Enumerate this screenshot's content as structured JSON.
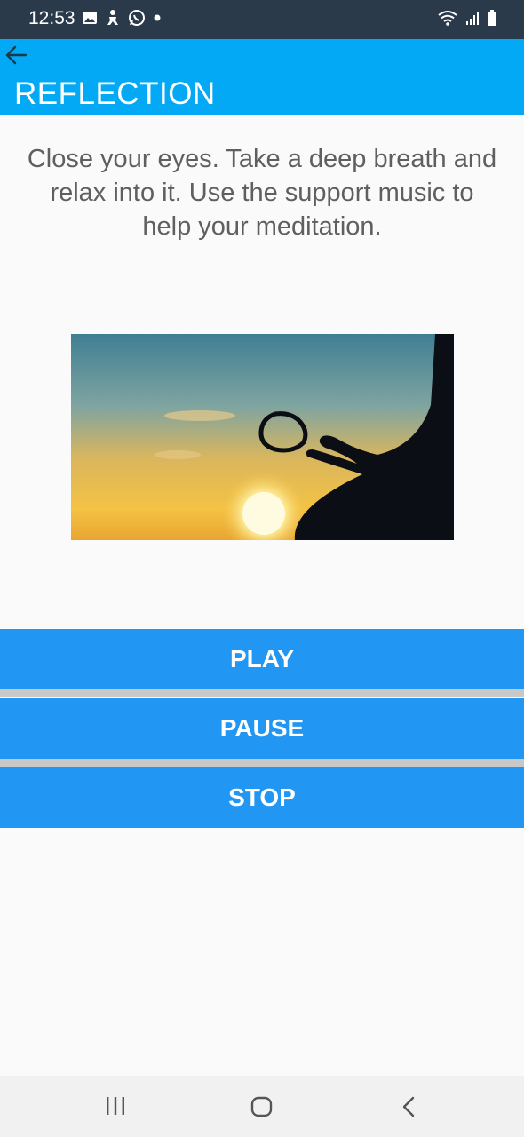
{
  "status_bar": {
    "time": "12:53",
    "icons_left": [
      "gallery-icon",
      "accessibility-icon",
      "whatsapp-icon",
      "notification-dot-icon"
    ],
    "icons_right": [
      "wifi-icon",
      "signal-icon",
      "battery-icon"
    ]
  },
  "app_bar": {
    "title": "REFLECTION",
    "color": "#03a9f4"
  },
  "main": {
    "instructions_line1": "Close your eyes. Take a deep breath and",
    "instructions_line2": "relax into it. Use the support music to",
    "instructions_line3": "help your meditation.",
    "image_alt": "meditation-sunset-image"
  },
  "controls": {
    "play_label": "PLAY",
    "pause_label": "PAUSE",
    "stop_label": "STOP",
    "button_color": "#2196f3"
  },
  "nav_bar": {
    "items": [
      "recent-apps-icon",
      "home-icon",
      "back-icon"
    ]
  }
}
